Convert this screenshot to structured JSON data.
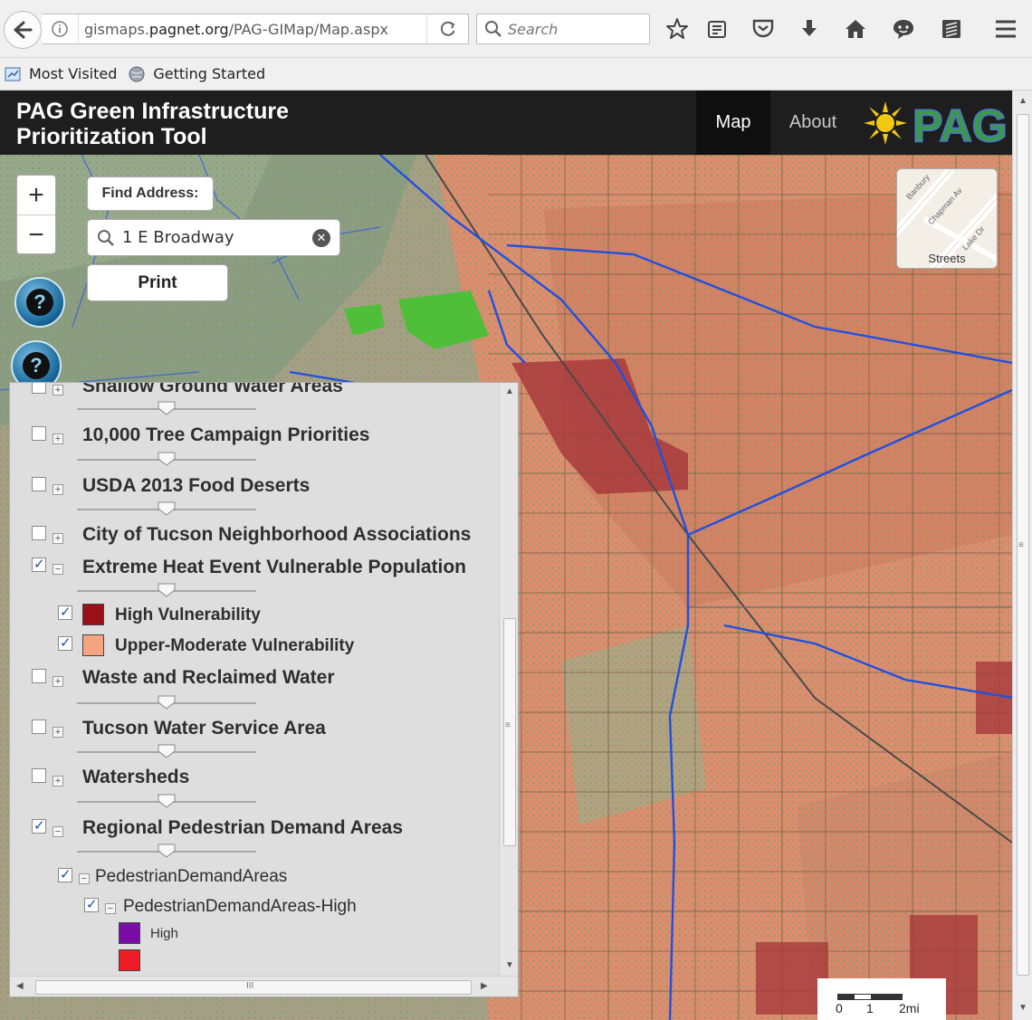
{
  "browser": {
    "url_prefix": "gismaps.",
    "url_domain": "pagnet.org",
    "url_path": "/PAG-GIMap/Map.aspx",
    "search_placeholder": "Search",
    "bookmarks": [
      "Most Visited",
      "Getting Started"
    ]
  },
  "app": {
    "title": "PAG Green Infrastructure\nPrioritization Tool",
    "nav": {
      "map": "Map",
      "about": "About"
    },
    "logo_text": "PAG",
    "colors": {
      "header_bg": "#1e1e1e",
      "logo_sun": "#f2c811",
      "logo_green": "#3a9a45",
      "logo_blue": "#4a7ab5"
    }
  },
  "map_controls": {
    "zoom_in": "+",
    "zoom_out": "−",
    "find_address_label": "Find Address:",
    "address_value": "1 E Broadway",
    "clear_symbol": "✕",
    "print_label": "Print",
    "help_symbol": "?",
    "basemap_label": "Streets",
    "basemap_streets": [
      "Banbury",
      "Chapman Av",
      "Lake Dr"
    ],
    "scale_labels": [
      "0",
      "1",
      "2mi"
    ]
  },
  "layers": [
    {
      "name": "Shallow Ground Water Areas",
      "checked": false
    },
    {
      "name": "10,000 Tree Campaign Priorities",
      "checked": false
    },
    {
      "name": "USDA 2013 Food Deserts",
      "checked": false
    },
    {
      "name": "City of Tucson Neighborhood Associations",
      "checked": false
    },
    {
      "name": "Extreme Heat Event Vulnerable Population",
      "checked": true
    },
    {
      "name": "Waste and Reclaimed Water",
      "checked": false
    },
    {
      "name": "Tucson Water Service Area",
      "checked": false
    },
    {
      "name": "Watersheds",
      "checked": false
    },
    {
      "name": "Regional Pedestrian Demand Areas",
      "checked": true
    }
  ],
  "heat_sublayers": [
    {
      "name": "High Vulnerability",
      "checked": true,
      "color": "#9b0f17"
    },
    {
      "name": "Upper-Moderate Vulnerability",
      "checked": true,
      "color": "#f4a57f"
    }
  ],
  "pedestrian_sublayers": {
    "group": "PedestrianDemandAreas",
    "subgroup": "PedestrianDemandAreas-High",
    "legend": [
      {
        "label": "High",
        "color": "#7a0da6"
      },
      {
        "label": "",
        "color": "#ee1c25"
      }
    ]
  },
  "panel_scroll": {
    "h_label": "III",
    "v_label": "≡"
  }
}
